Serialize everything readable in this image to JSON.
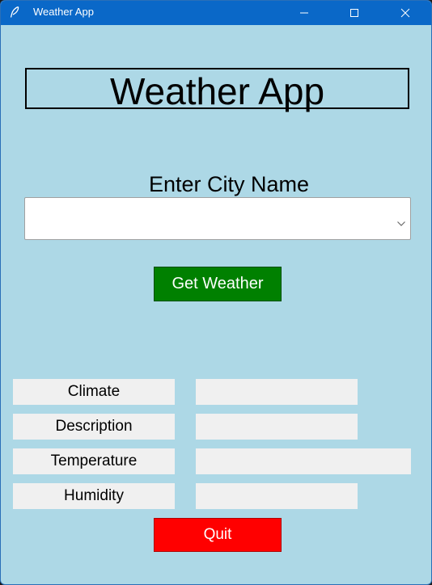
{
  "window": {
    "title": "Weather App",
    "app_icon": "feather-icon",
    "controls": {
      "minimize_icon": "minimize-icon",
      "maximize_icon": "maximize-icon",
      "close_icon": "close-icon"
    },
    "titlebar_color": "#0a68c8",
    "background_color": "#add8e6"
  },
  "heading": {
    "text": "Weather App"
  },
  "city": {
    "label": "Enter City Name",
    "value": "",
    "dropdown_icon": "chevron-down-icon"
  },
  "get_weather": {
    "label": "Get Weather",
    "color": "#008000"
  },
  "fields": [
    {
      "label": "Climate",
      "value": ""
    },
    {
      "label": "Description",
      "value": ""
    },
    {
      "label": "Temperature",
      "value": ""
    },
    {
      "label": "Humidity",
      "value": ""
    }
  ],
  "quit": {
    "label": "Quit",
    "color": "#ff0000"
  }
}
